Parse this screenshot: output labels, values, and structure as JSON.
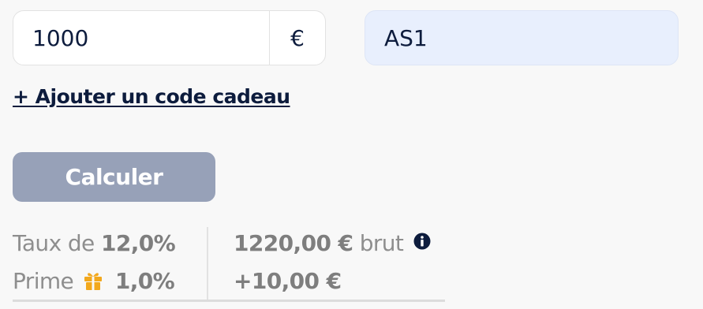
{
  "amount": {
    "value": "1000",
    "unit": "€"
  },
  "code": {
    "value": "AS1"
  },
  "gift_link": {
    "label": "+ Ajouter un code cadeau"
  },
  "calculate_button": {
    "label": "Calculer"
  },
  "results": {
    "rate_label": "Taux de",
    "rate_value": "12,0%",
    "bonus_label": "Prime",
    "bonus_value": "1,0%",
    "gross_value": "1220,00 €",
    "gross_label": "brut",
    "bonus_amount": "+10,00 €"
  },
  "colors": {
    "accent_navy": "#0d1c3d",
    "button_bg": "#97a1b8",
    "code_field_bg": "#e8effd",
    "gift_icon": "#f2a81d"
  },
  "icons": {
    "gift": "gift-icon",
    "info": "info-icon"
  }
}
